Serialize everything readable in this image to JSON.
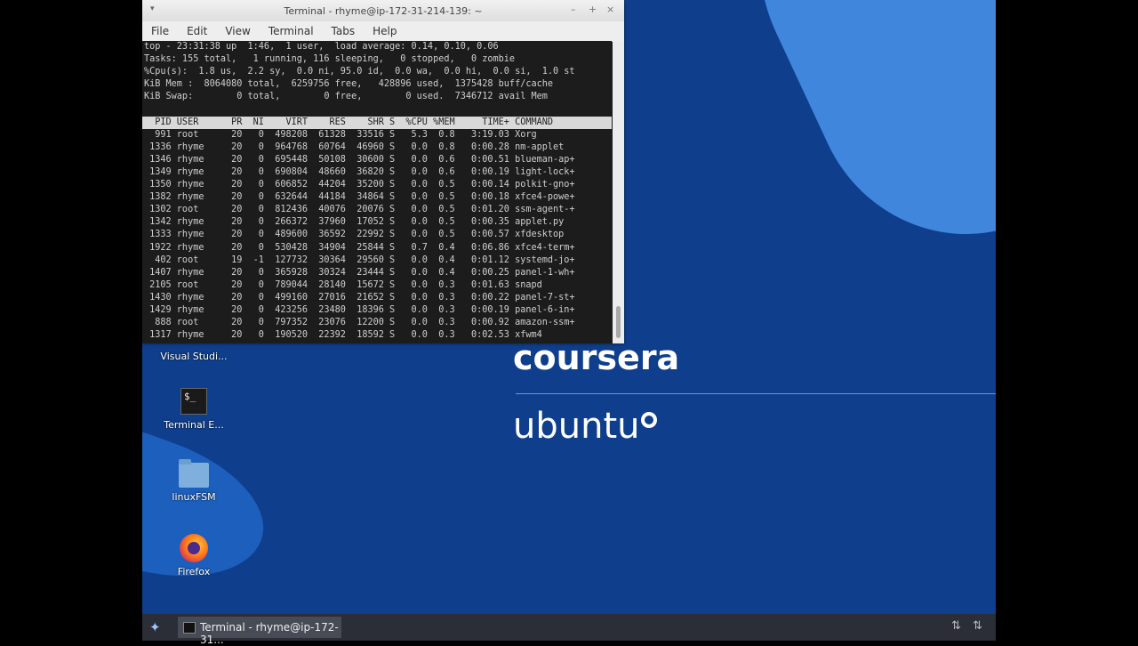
{
  "window": {
    "title": "Terminal - rhyme@ip-172-31-214-139: ~",
    "menu_glyph": "▾",
    "min": "–",
    "max": "+",
    "close": "×"
  },
  "menubar": [
    "File",
    "Edit",
    "View",
    "Terminal",
    "Tabs",
    "Help"
  ],
  "top": {
    "summary": [
      "top - 23:31:38 up  1:46,  1 user,  load average: 0.14, 0.10, 0.06",
      "Tasks: 155 total,   1 running, 116 sleeping,   0 stopped,   0 zombie",
      "%Cpu(s):  1.8 us,  2.2 sy,  0.0 ni, 95.0 id,  0.0 wa,  0.0 hi,  0.0 si,  1.0 st",
      "KiB Mem :  8064080 total,  6259756 free,   428896 used,  1375428 buff/cache",
      "KiB Swap:        0 total,        0 free,        0 used.  7346712 avail Mem"
    ],
    "header": "  PID USER      PR  NI    VIRT    RES    SHR S  %CPU %MEM     TIME+ COMMAND",
    "processes": [
      "  991 root      20   0  498208  61328  33516 S   5.3  0.8   3:19.03 Xorg",
      " 1336 rhyme     20   0  964768  60764  46960 S   0.0  0.8   0:00.28 nm-applet",
      " 1346 rhyme     20   0  695448  50108  30600 S   0.0  0.6   0:00.51 blueman-ap+",
      " 1349 rhyme     20   0  690804  48660  36820 S   0.0  0.6   0:00.19 light-lock+",
      " 1350 rhyme     20   0  606852  44204  35200 S   0.0  0.5   0:00.14 polkit-gno+",
      " 1382 rhyme     20   0  632644  44184  34864 S   0.0  0.5   0:00.18 xfce4-powe+",
      " 1302 root      20   0  812436  40076  20076 S   0.0  0.5   0:01.20 ssm-agent-+",
      " 1342 rhyme     20   0  266372  37960  17052 S   0.0  0.5   0:00.35 applet.py",
      " 1333 rhyme     20   0  489600  36592  22992 S   0.0  0.5   0:00.57 xfdesktop",
      " 1922 rhyme     20   0  530428  34904  25844 S   0.7  0.4   0:06.86 xfce4-term+",
      "  402 root      19  -1  127732  30364  29560 S   0.0  0.4   0:01.12 systemd-jo+",
      " 1407 rhyme     20   0  365928  30324  23444 S   0.0  0.4   0:00.25 panel-1-wh+",
      " 2105 root      20   0  789044  28140  15672 S   0.0  0.3   0:01.63 snapd",
      " 1430 rhyme     20   0  499160  27016  21652 S   0.0  0.3   0:00.22 panel-7-st+",
      " 1429 rhyme     20   0  423256  23480  18396 S   0.0  0.3   0:00.19 panel-6-in+",
      "  888 root      20   0  797352  23076  12200 S   0.0  0.3   0:00.92 amazon-ssm+",
      " 1317 rhyme     20   0  190520  22392  18592 S   0.0  0.3   0:02.53 xfwm4"
    ]
  },
  "desktop": {
    "icons": [
      {
        "label": "Visual Studi...",
        "icon": "vscode-icon"
      },
      {
        "label": "Terminal E...",
        "icon": "terminal-icon",
        "glyph": "$_"
      },
      {
        "label": "linuxFSM",
        "icon": "folder-icon"
      },
      {
        "label": "Firefox",
        "icon": "firefox-icon"
      }
    ],
    "brand_coursera": "coursera",
    "brand_ubuntu": "ubuntu",
    "colors": {
      "background": "#0f3f8c",
      "accent": "#3f86dc"
    }
  },
  "taskbar": {
    "menu_glyph": "✦",
    "task_label": "Terminal - rhyme@ip-172-31...",
    "tray_glyph": "⇅"
  }
}
